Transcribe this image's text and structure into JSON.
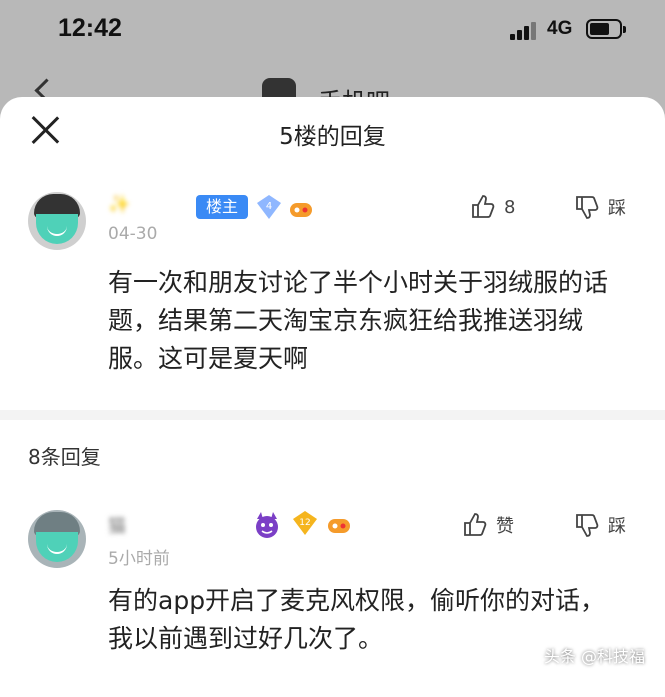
{
  "status_bar": {
    "time": "12:42",
    "network": "4G"
  },
  "background_page": {
    "title": "手机吧"
  },
  "sheet": {
    "title": "5楼的回复",
    "main_comment": {
      "username": "✨",
      "owner_badge": "楼主",
      "level": "4",
      "date": "04-30",
      "body": "有一次和朋友讨论了半个小时关于羽绒服的话题，结果第二天淘宝京东疯狂给我推送羽绒服。这可是夏天啊",
      "like_count": "8",
      "dislike_label": "踩"
    },
    "reply_count": "8条回复",
    "reply": {
      "username": "猫",
      "level": "12",
      "date": "5小时前",
      "body": "有的app开启了麦克风权限，偷听你的对话，我以前遇到过好几次了。",
      "like_label": "赞",
      "dislike_label": "踩"
    }
  },
  "watermark": "头条 @科技福",
  "colors": {
    "badge_blue": "#3a8af5",
    "avatar_mask": "#4fd1b8"
  }
}
